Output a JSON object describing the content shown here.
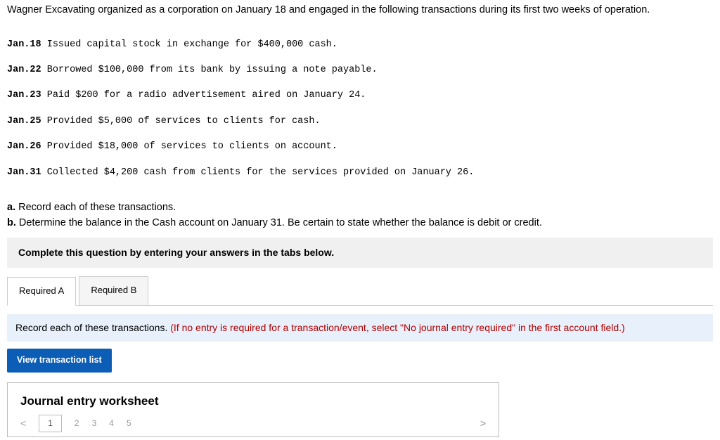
{
  "intro": "Wagner Excavating organized as a corporation on January 18 and engaged in the following transactions during its first two weeks of operation.",
  "transactions": [
    {
      "date": "Jan.18",
      "text": "Issued capital stock in exchange for $400,000 cash."
    },
    {
      "date": "Jan.22",
      "text": "Borrowed $100,000 from its bank by issuing a note payable."
    },
    {
      "date": "Jan.23",
      "text": "Paid $200 for a radio advertisement aired on January 24."
    },
    {
      "date": "Jan.25",
      "text": "Provided $5,000 of services to clients for cash."
    },
    {
      "date": "Jan.26",
      "text": "Provided $18,000 of services to clients on account."
    },
    {
      "date": "Jan.31",
      "text": "Collected $4,200 cash from clients for the services provided on January 26."
    }
  ],
  "requirements": {
    "a_label": "a.",
    "a_text": "Record each of these transactions.",
    "b_label": "b.",
    "b_text": "Determine the balance in the Cash account on January 31. Be certain to state whether the balance is debit or credit."
  },
  "panel": {
    "prompt": "Complete this question by entering your answers in the tabs below.",
    "tabs": {
      "a": "Required A",
      "b": "Required B"
    },
    "instruction_plain": "Record each of these transactions. ",
    "instruction_red": "(If no entry is required for a transaction/event, select \"No journal entry required\" in the first account field.)",
    "view_btn": "View transaction list",
    "worksheet_title": "Journal entry worksheet",
    "nav": {
      "prev": "<",
      "p1": "1",
      "p2": "2",
      "p3": "3",
      "p4": "4",
      "p5": "5",
      "next": ">"
    }
  }
}
